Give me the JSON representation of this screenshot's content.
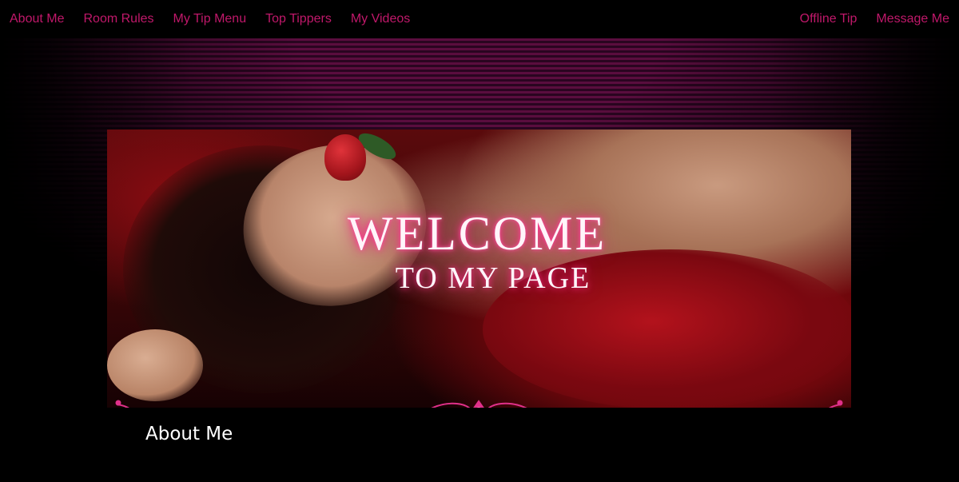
{
  "nav": {
    "left": [
      {
        "label": "About Me"
      },
      {
        "label": "Room Rules"
      },
      {
        "label": "My Tip Menu"
      },
      {
        "label": "Top Tippers"
      },
      {
        "label": "My Videos"
      }
    ],
    "right": [
      {
        "label": "Offline Tip"
      },
      {
        "label": "Message Me"
      }
    ]
  },
  "banner": {
    "welcome": "WELCOME",
    "subtitle": "TO MY PAGE"
  },
  "section": {
    "heading": "About Me"
  },
  "colors": {
    "nav_link": "#c0186a",
    "stripe_light": "#5a0d3e",
    "stripe_dark": "#2a0520",
    "ornament": "#e0308a",
    "glow": "#ff2e8a"
  }
}
